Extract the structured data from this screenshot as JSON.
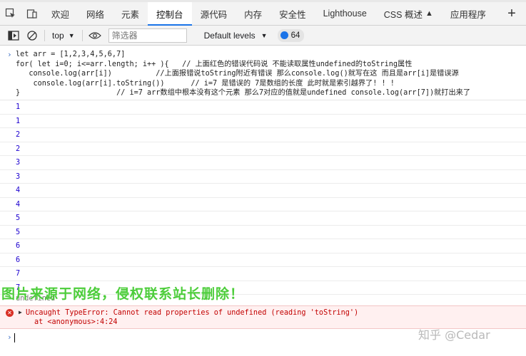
{
  "tabs": [
    {
      "label": "欢迎",
      "active": false
    },
    {
      "label": "网络",
      "active": false
    },
    {
      "label": "元素",
      "active": false
    },
    {
      "label": "控制台",
      "active": true
    },
    {
      "label": "源代码",
      "active": false
    },
    {
      "label": "内存",
      "active": false
    },
    {
      "label": "安全性",
      "active": false
    },
    {
      "label": "Lighthouse",
      "active": false
    },
    {
      "label": "CSS 概述",
      "active": false
    },
    {
      "label": "应用程序",
      "active": false
    }
  ],
  "toolbar": {
    "context": "top",
    "filter_placeholder": "筛选器",
    "levels": "Default levels",
    "message_count": "64"
  },
  "console": {
    "code_lines": [
      "let arr = [1,2,3,4,5,6,7]",
      "for( let i=0; i<=arr.length; i++ ){   // 上面红色的错误代码说 不能读取属性undefined的toString属性",
      "   console.log(arr[i])          //上面报错说toString附近有错误 那么console.log()就写在这 而且是arr[i]是错误源",
      "    console.log(arr[i].toString())      // i=7 是错误的 7是数组的长度 此时就是索引越界了! ! !",
      "}                      // i=7 arr数组中根本没有这个元素 那么7对应的值就是undefined console.log(arr[7])就打出来了"
    ],
    "logs": [
      "1",
      "1",
      "2",
      "2",
      "3",
      "3",
      "4",
      "4",
      "5",
      "5",
      "6",
      "6",
      "7",
      "7"
    ],
    "undefined_output": "undefined",
    "error": {
      "message": "Uncaught TypeError: Cannot read properties of undefined (reading 'toString')",
      "location": "at <anonymous>:4:24"
    }
  },
  "watermark": "图片来源于网络，侵权联系站长删除！",
  "credit": "知乎 @Cedar"
}
